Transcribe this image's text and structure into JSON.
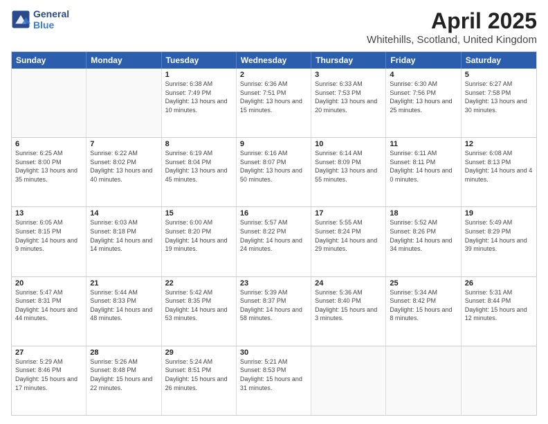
{
  "header": {
    "logo_line1": "General",
    "logo_line2": "Blue",
    "title": "April 2025",
    "subtitle": "Whitehills, Scotland, United Kingdom"
  },
  "days_of_week": [
    "Sunday",
    "Monday",
    "Tuesday",
    "Wednesday",
    "Thursday",
    "Friday",
    "Saturday"
  ],
  "weeks": [
    [
      {
        "day": "",
        "info": ""
      },
      {
        "day": "",
        "info": ""
      },
      {
        "day": "1",
        "info": "Sunrise: 6:38 AM\nSunset: 7:49 PM\nDaylight: 13 hours and 10 minutes."
      },
      {
        "day": "2",
        "info": "Sunrise: 6:36 AM\nSunset: 7:51 PM\nDaylight: 13 hours and 15 minutes."
      },
      {
        "day": "3",
        "info": "Sunrise: 6:33 AM\nSunset: 7:53 PM\nDaylight: 13 hours and 20 minutes."
      },
      {
        "day": "4",
        "info": "Sunrise: 6:30 AM\nSunset: 7:56 PM\nDaylight: 13 hours and 25 minutes."
      },
      {
        "day": "5",
        "info": "Sunrise: 6:27 AM\nSunset: 7:58 PM\nDaylight: 13 hours and 30 minutes."
      }
    ],
    [
      {
        "day": "6",
        "info": "Sunrise: 6:25 AM\nSunset: 8:00 PM\nDaylight: 13 hours and 35 minutes."
      },
      {
        "day": "7",
        "info": "Sunrise: 6:22 AM\nSunset: 8:02 PM\nDaylight: 13 hours and 40 minutes."
      },
      {
        "day": "8",
        "info": "Sunrise: 6:19 AM\nSunset: 8:04 PM\nDaylight: 13 hours and 45 minutes."
      },
      {
        "day": "9",
        "info": "Sunrise: 6:16 AM\nSunset: 8:07 PM\nDaylight: 13 hours and 50 minutes."
      },
      {
        "day": "10",
        "info": "Sunrise: 6:14 AM\nSunset: 8:09 PM\nDaylight: 13 hours and 55 minutes."
      },
      {
        "day": "11",
        "info": "Sunrise: 6:11 AM\nSunset: 8:11 PM\nDaylight: 14 hours and 0 minutes."
      },
      {
        "day": "12",
        "info": "Sunrise: 6:08 AM\nSunset: 8:13 PM\nDaylight: 14 hours and 4 minutes."
      }
    ],
    [
      {
        "day": "13",
        "info": "Sunrise: 6:05 AM\nSunset: 8:15 PM\nDaylight: 14 hours and 9 minutes."
      },
      {
        "day": "14",
        "info": "Sunrise: 6:03 AM\nSunset: 8:18 PM\nDaylight: 14 hours and 14 minutes."
      },
      {
        "day": "15",
        "info": "Sunrise: 6:00 AM\nSunset: 8:20 PM\nDaylight: 14 hours and 19 minutes."
      },
      {
        "day": "16",
        "info": "Sunrise: 5:57 AM\nSunset: 8:22 PM\nDaylight: 14 hours and 24 minutes."
      },
      {
        "day": "17",
        "info": "Sunrise: 5:55 AM\nSunset: 8:24 PM\nDaylight: 14 hours and 29 minutes."
      },
      {
        "day": "18",
        "info": "Sunrise: 5:52 AM\nSunset: 8:26 PM\nDaylight: 14 hours and 34 minutes."
      },
      {
        "day": "19",
        "info": "Sunrise: 5:49 AM\nSunset: 8:29 PM\nDaylight: 14 hours and 39 minutes."
      }
    ],
    [
      {
        "day": "20",
        "info": "Sunrise: 5:47 AM\nSunset: 8:31 PM\nDaylight: 14 hours and 44 minutes."
      },
      {
        "day": "21",
        "info": "Sunrise: 5:44 AM\nSunset: 8:33 PM\nDaylight: 14 hours and 48 minutes."
      },
      {
        "day": "22",
        "info": "Sunrise: 5:42 AM\nSunset: 8:35 PM\nDaylight: 14 hours and 53 minutes."
      },
      {
        "day": "23",
        "info": "Sunrise: 5:39 AM\nSunset: 8:37 PM\nDaylight: 14 hours and 58 minutes."
      },
      {
        "day": "24",
        "info": "Sunrise: 5:36 AM\nSunset: 8:40 PM\nDaylight: 15 hours and 3 minutes."
      },
      {
        "day": "25",
        "info": "Sunrise: 5:34 AM\nSunset: 8:42 PM\nDaylight: 15 hours and 8 minutes."
      },
      {
        "day": "26",
        "info": "Sunrise: 5:31 AM\nSunset: 8:44 PM\nDaylight: 15 hours and 12 minutes."
      }
    ],
    [
      {
        "day": "27",
        "info": "Sunrise: 5:29 AM\nSunset: 8:46 PM\nDaylight: 15 hours and 17 minutes."
      },
      {
        "day": "28",
        "info": "Sunrise: 5:26 AM\nSunset: 8:48 PM\nDaylight: 15 hours and 22 minutes."
      },
      {
        "day": "29",
        "info": "Sunrise: 5:24 AM\nSunset: 8:51 PM\nDaylight: 15 hours and 26 minutes."
      },
      {
        "day": "30",
        "info": "Sunrise: 5:21 AM\nSunset: 8:53 PM\nDaylight: 15 hours and 31 minutes."
      },
      {
        "day": "",
        "info": ""
      },
      {
        "day": "",
        "info": ""
      },
      {
        "day": "",
        "info": ""
      }
    ]
  ]
}
